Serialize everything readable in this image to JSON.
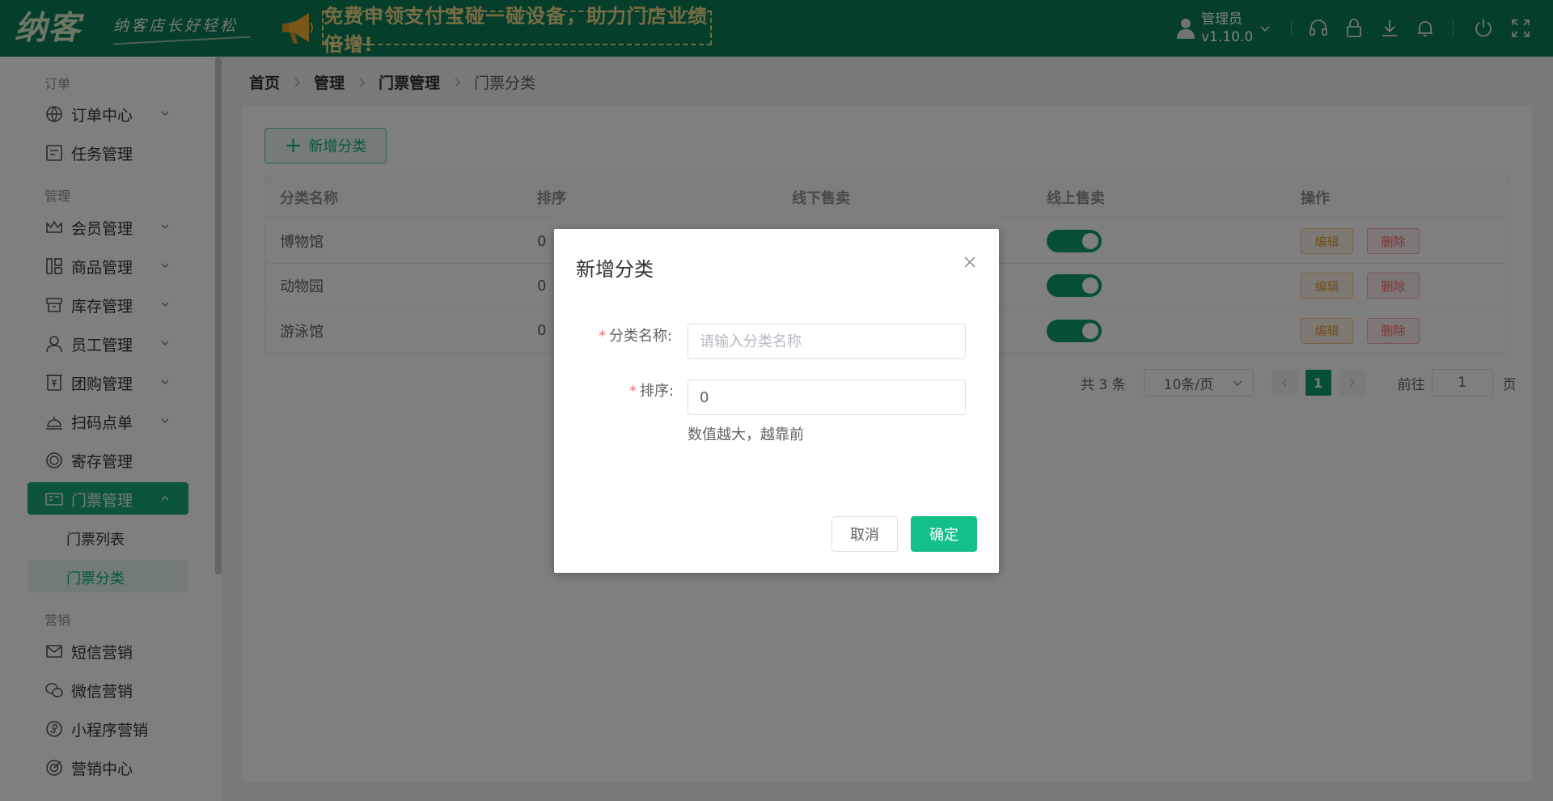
{
  "header": {
    "logo": "纳客",
    "slogan": "纳客店长好轻松",
    "banner": "免费申领支付宝碰一碰设备，助力门店业绩倍增!",
    "user_name": "管理员",
    "version": "v1.10.0",
    "icons": [
      "headset-icon",
      "lock-icon",
      "download-icon",
      "bell-icon",
      "power-icon",
      "fullscreen-icon"
    ]
  },
  "sidebar": {
    "groups": [
      "订单",
      "管理",
      "营销"
    ],
    "order_items": [
      "订单中心",
      "任务管理"
    ],
    "manage_items": [
      "会员管理",
      "商品管理",
      "库存管理",
      "员工管理",
      "团购管理",
      "扫码点单",
      "寄存管理",
      "门票管理"
    ],
    "ticket_sub": [
      "门票列表",
      "门票分类"
    ],
    "marketing_items": [
      "短信营销",
      "微信营销",
      "小程序营销",
      "营销中心"
    ]
  },
  "breadcrumb": [
    "首页",
    "管理",
    "门票管理",
    "门票分类"
  ],
  "toolbar": {
    "add_label": "新增分类"
  },
  "table": {
    "columns": [
      "分类名称",
      "排序",
      "线下售卖",
      "线上售卖",
      "操作"
    ],
    "rows": [
      {
        "name": "博物馆",
        "sort": "0",
        "online": true
      },
      {
        "name": "动物园",
        "sort": "0",
        "online": true
      },
      {
        "name": "游泳馆",
        "sort": "0",
        "online": true
      }
    ],
    "edit_label": "编辑",
    "delete_label": "删除"
  },
  "pagination": {
    "total": "共 3 条",
    "page_size": "10条/页",
    "current_page": "1",
    "goto_label": "前往",
    "goto_value": "1",
    "page_suffix": "页"
  },
  "dialog": {
    "title": "新增分类",
    "name_label": "分类名称:",
    "name_placeholder": "请输入分类名称",
    "name_value": "",
    "sort_label": "排序:",
    "sort_value": "0",
    "hint": "数值越大，越靠前",
    "cancel_label": "取消",
    "confirm_label": "确定"
  },
  "colors": {
    "header_bg": "#0b7d57",
    "accent": "#13c08a",
    "edit": "#e6a23c",
    "delete": "#f56c6c"
  }
}
